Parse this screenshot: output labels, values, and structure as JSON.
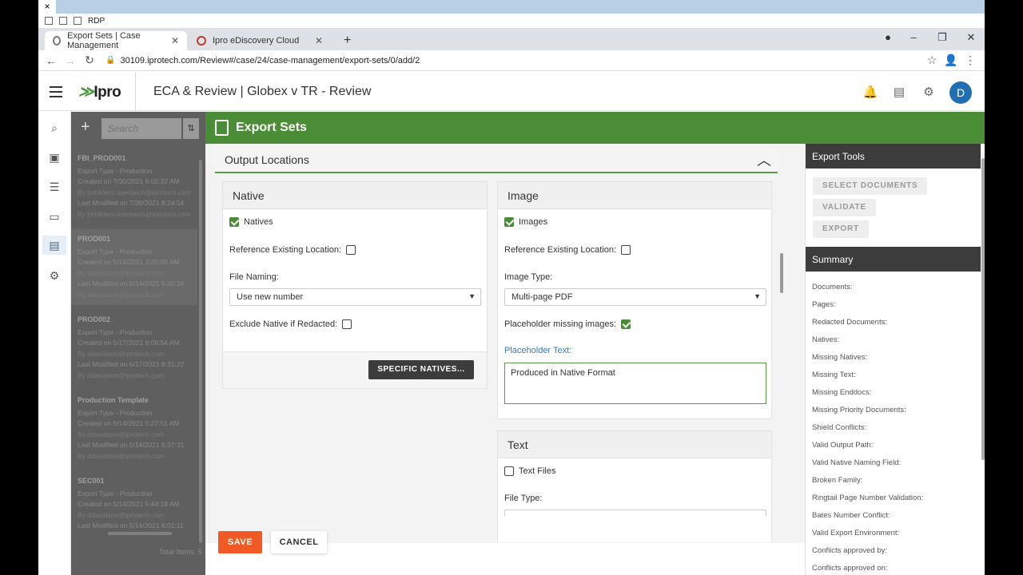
{
  "rdp": {
    "label": "RDP",
    "close": "×"
  },
  "browser": {
    "tabs": [
      {
        "title": "Export Sets | Case Management"
      },
      {
        "title": "Ipro eDiscovery Cloud"
      }
    ],
    "new_tab": "+",
    "url": "30109.iprotech.com/Review#/case/24/case-management/export-sets/0/add/2"
  },
  "app": {
    "logo": "Ipro",
    "title": "ECA & Review | Globex v TR - Review",
    "avatar": "D"
  },
  "list": {
    "search_placeholder": "Search",
    "items": [
      {
        "name": "FBI_PROD001",
        "type": "Export Type - Production",
        "created": "Created on 7/30/2021 8:02:32 AM",
        "by": "By pchilders-aaerbech@iprotech.com",
        "modified": "Last Modified on 7/30/2021 8:24:54",
        "by2": "By pchilders-aaerbech@iprotech.com"
      },
      {
        "name": "PROD001",
        "type": "Export Type - Production",
        "created": "Created on 5/14/2021 3:20:06 AM",
        "by": "By ddavidson@iprotech.com",
        "modified": "Last Modified on 5/14/2021 5:40:24",
        "by2": "By ddavidson@iprotech.com"
      },
      {
        "name": "PROD002",
        "type": "Export Type - Production",
        "created": "Created on 5/17/2021 8:09:54 AM",
        "by": "By ddavidson@iprotech.com",
        "modified": "Last Modified on 6/17/2021 8:31:22",
        "by2": "By ddavidson@iprotech.com"
      },
      {
        "name": "Production Template",
        "type": "Export Type - Production",
        "created": "Created on 5/14/2021 5:27:51 AM",
        "by": "By ddavidson@iprotech.com",
        "modified": "Last Modified on 5/14/2021 5:37:31",
        "by2": "By ddavidson@iprotech.com"
      },
      {
        "name": "SEC001",
        "type": "Export Type - Production",
        "created": "Created on 5/14/2021 5:44:18 AM",
        "by": "By ddavidson@iprotech.com",
        "modified": "Last Modified on 5/14/2021 6:01:11",
        "by2": ""
      }
    ],
    "total": "Total Items: 5"
  },
  "export_sets": {
    "title": "Export Sets"
  },
  "output_locations": {
    "title": "Output Locations"
  },
  "native": {
    "title": "Native",
    "natives_label": "Natives",
    "ref_label": "Reference Existing Location:",
    "file_naming_label": "File Naming:",
    "file_naming_value": "Use new number",
    "exclude_label": "Exclude Native if Redacted:",
    "specific_btn": "SPECIFIC NATIVES..."
  },
  "image": {
    "title": "Image",
    "images_label": "Images",
    "ref_label": "Reference Existing Location:",
    "type_label": "Image Type:",
    "type_value": "Multi-page PDF",
    "placeholder_missing_label": "Placeholder missing images:",
    "placeholder_text_label": "Placeholder Text:",
    "placeholder_text_value": "Produced in Native Format"
  },
  "text": {
    "title": "Text",
    "files_label": "Text Files",
    "file_type_label": "File Type:"
  },
  "actions": {
    "save": "SAVE",
    "cancel": "CANCEL"
  },
  "tools": {
    "title": "Export Tools",
    "select_documents": "SELECT DOCUMENTS",
    "validate": "VALIDATE",
    "export": "EXPORT"
  },
  "summary": {
    "title": "Summary",
    "rows": [
      "Documents:",
      "Pages:",
      "Redacted Documents:",
      "Natives:",
      "Missing Natives:",
      "Missing Text:",
      "Missing Enddocs:",
      "Missing Priority Documents:",
      "Shield Conflicts:",
      "Valid Output Path:",
      "Valid Native Naming Field:",
      "Broken Family:",
      "Ringtail Page Number Validation:",
      "Bates Number Conflict:",
      "Valid Export Environment:",
      "Conflicts approved by:",
      "Conflicts approved on:"
    ]
  },
  "colors": {
    "brand_green": "#4b8c36",
    "save_orange": "#f15a24",
    "avatar_blue": "#1f6fb2"
  }
}
